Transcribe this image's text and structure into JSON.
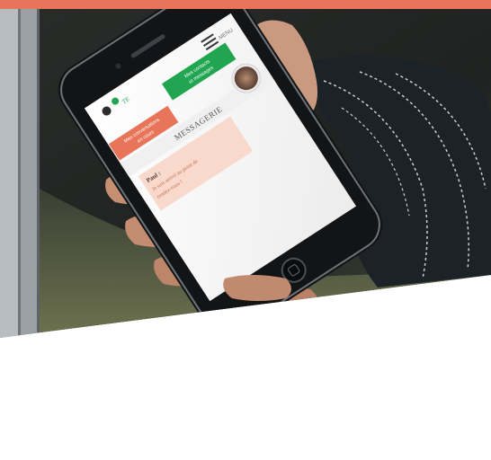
{
  "phone_screen": {
    "header_title": "MESSAGERIE",
    "menu_label": "MENU",
    "green_button_line1": "Mes contacts",
    "green_button_line2": "et messages",
    "orange_button_line1": "Mes conversations",
    "orange_button_line2": "en cours",
    "message_sender": "Paul :",
    "message_line1": "Je suis arrivé au point de",
    "message_line2": "rendez-vous !"
  },
  "colors": {
    "accent_orange": "#e8745a",
    "button_green": "#21a551",
    "bubble_pink": "#f8d9cc"
  }
}
